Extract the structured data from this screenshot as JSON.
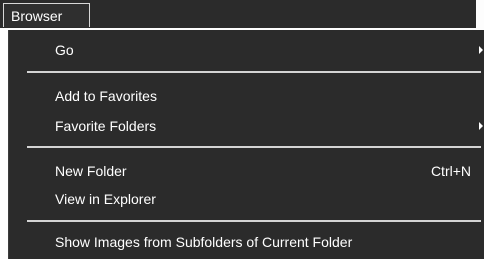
{
  "menubar": {
    "title": "Browser"
  },
  "menu": {
    "go": {
      "label": "Go"
    },
    "add_to_favorites": {
      "label": "Add to Favorites"
    },
    "favorite_folders": {
      "label": "Favorite Folders"
    },
    "new_folder": {
      "label": "New Folder",
      "shortcut": "Ctrl+N"
    },
    "view_in_explorer": {
      "label": "View in Explorer"
    },
    "show_images_subfolders": {
      "label": "Show Images from Subfolders of Current Folder"
    }
  },
  "icons": {
    "submenu": "chevron-right-icon"
  },
  "colors": {
    "menu_background": "#2b2b2b",
    "menu_text": "#ffffff",
    "separator": "#d4d4d4",
    "page_background": "#fdfdfd"
  }
}
